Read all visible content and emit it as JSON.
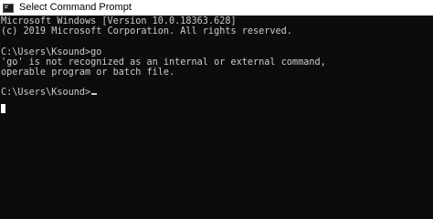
{
  "window": {
    "title": "Select Command Prompt",
    "icon": "cmd-icon"
  },
  "console": {
    "lines": [
      "Microsoft Windows [Version 10.0.18363.628]",
      "(c) 2019 Microsoft Corporation. All rights reserved.",
      "",
      "C:\\Users\\Ksound>go",
      "'go' is not recognized as an internal or external command,",
      "operable program or batch file.",
      "",
      "C:\\Users\\Ksound>"
    ],
    "text_color": "#cccccc",
    "background_color": "#0c0c0c"
  }
}
